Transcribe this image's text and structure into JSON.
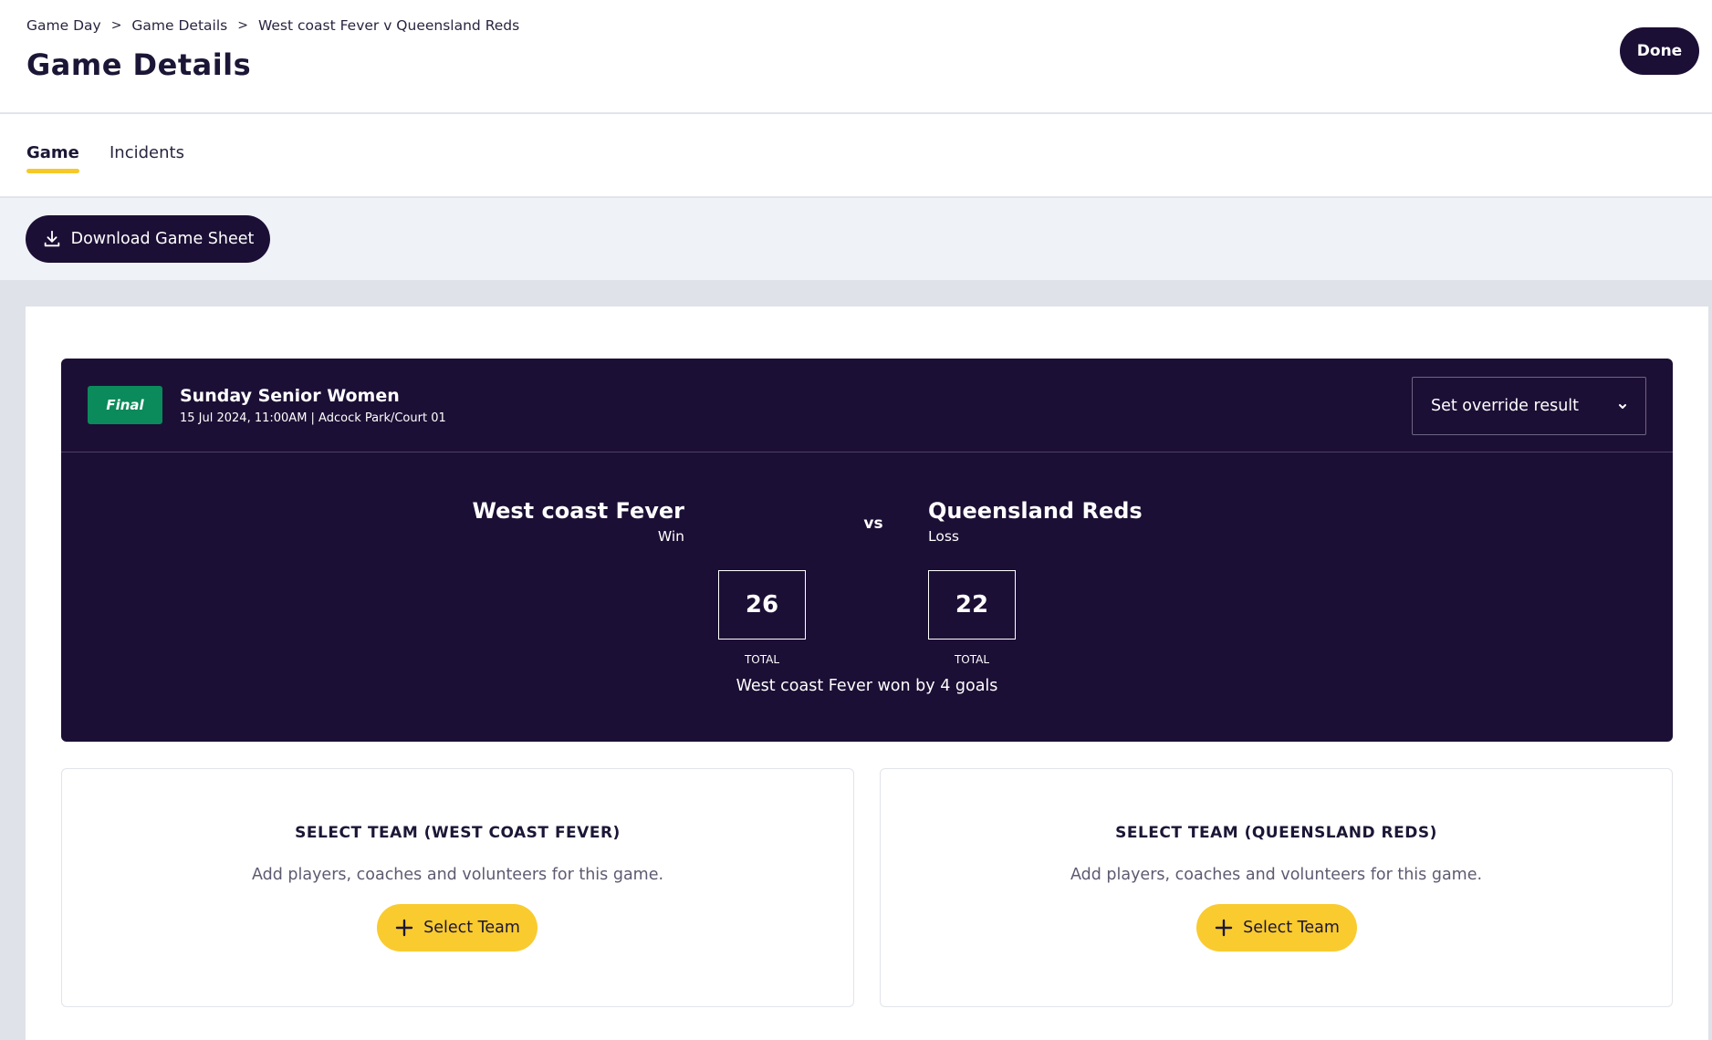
{
  "breadcrumb": {
    "items": [
      "Game Day",
      "Game Details",
      "West coast Fever v Queensland Reds"
    ],
    "separator": ">"
  },
  "header": {
    "title": "Game Details",
    "done_label": "Done"
  },
  "tabs": [
    {
      "label": "Game",
      "active": true
    },
    {
      "label": "Incidents",
      "active": false
    }
  ],
  "actions": {
    "download_label": "Download Game Sheet",
    "download_icon": "download-icon"
  },
  "game": {
    "status": "Final",
    "competition": "Sunday Senior Women",
    "meta": "15 Jul 2024, 11:00AM | Adcock Park/Court 01",
    "override_label": "Set override result",
    "vs_label": "vs",
    "home": {
      "name": "West coast Fever",
      "result": "Win",
      "score": "26",
      "total_label": "TOTAL"
    },
    "away": {
      "name": "Queensland Reds",
      "result": "Loss",
      "score": "22",
      "total_label": "TOTAL"
    },
    "result_text": "West coast Fever won by 4 goals"
  },
  "panels": {
    "home": {
      "title": "SELECT TEAM (WEST COAST FEVER)",
      "subtitle": "Add players, coaches and volunteers for this game.",
      "button_label": "Select Team"
    },
    "away": {
      "title": "SELECT TEAM (QUEENSLAND REDS)",
      "subtitle": "Add players, coaches and volunteers for this game.",
      "button_label": "Select Team"
    }
  },
  "colors": {
    "primary_dark": "#1c0f35",
    "accent_yellow": "#f9cb2f",
    "status_green": "#0b8a5b",
    "page_bg": "#dfe2e8"
  }
}
